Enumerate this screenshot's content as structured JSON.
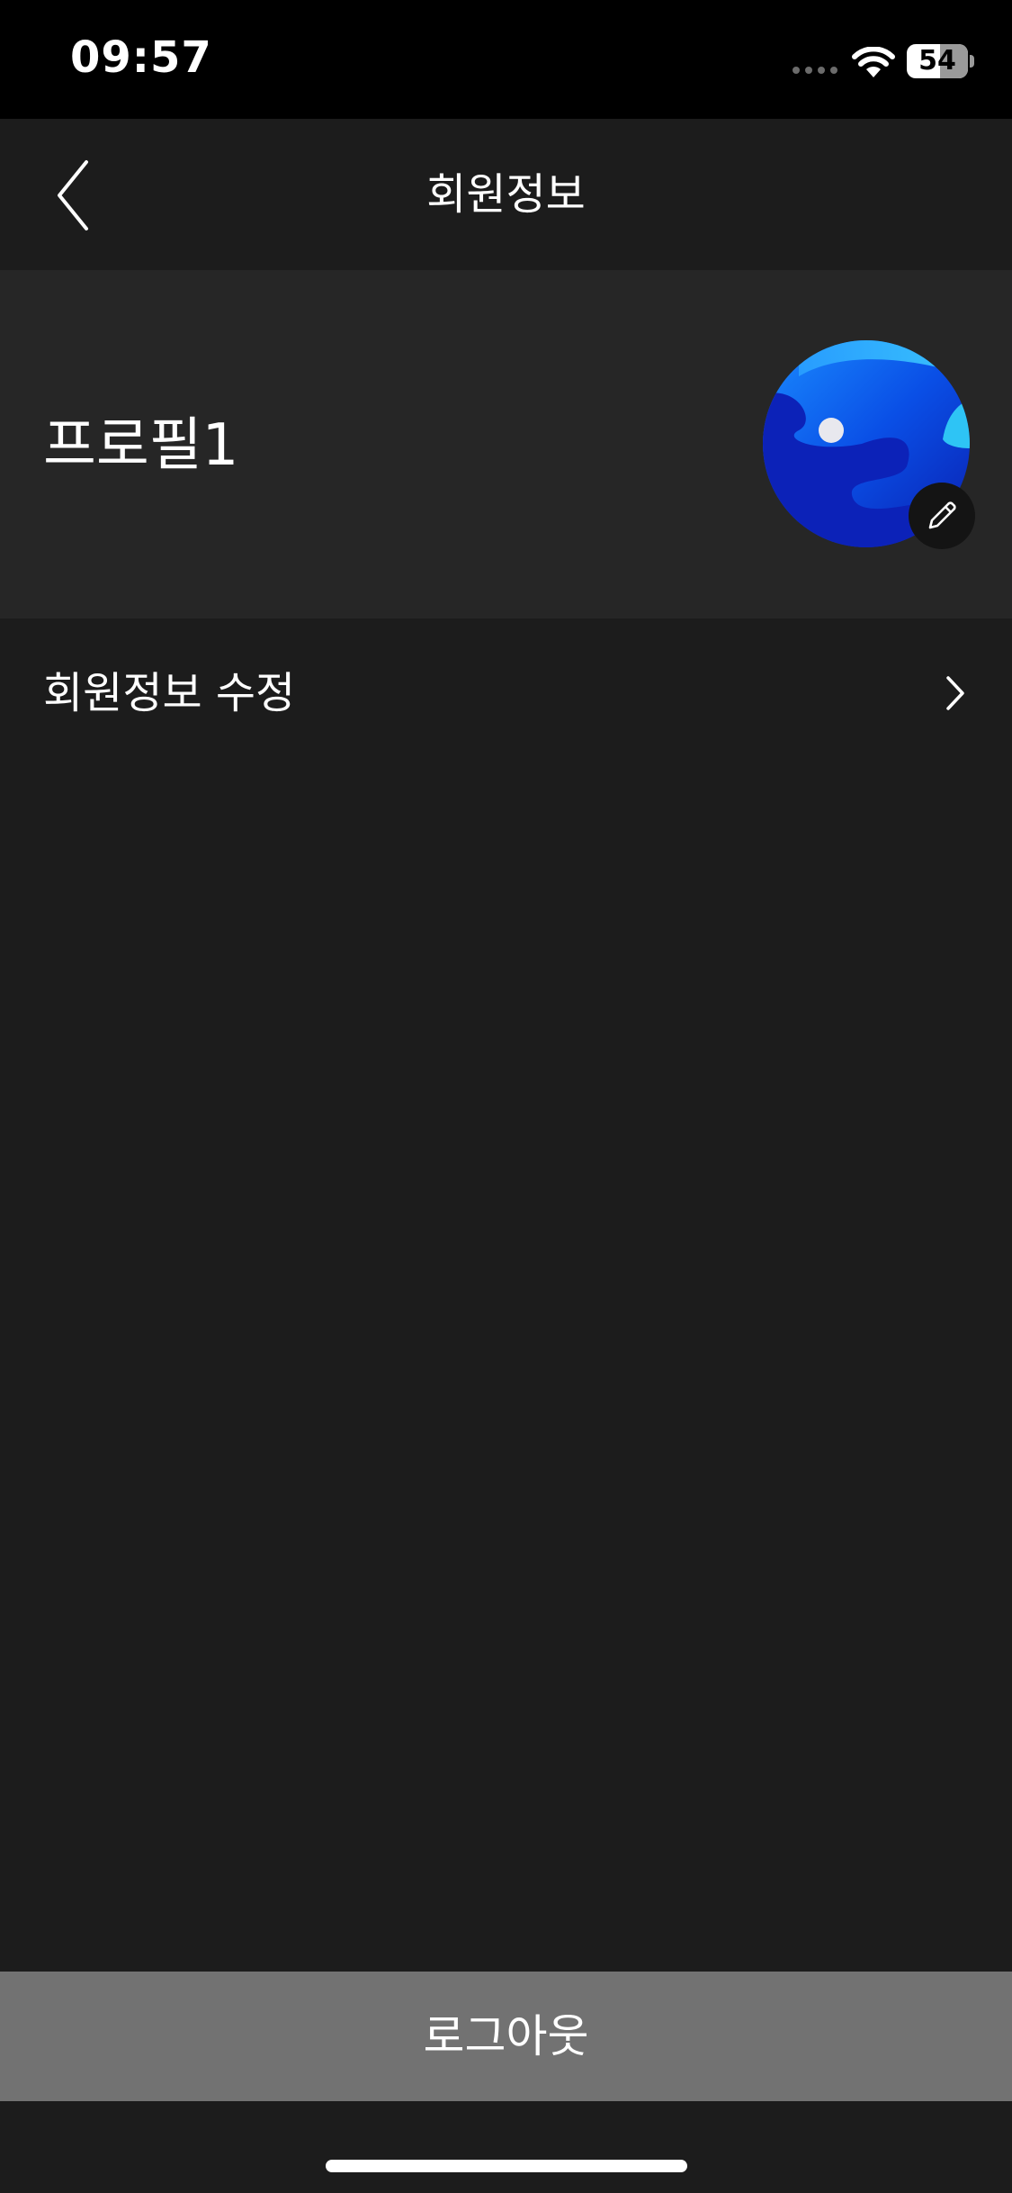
{
  "status_bar": {
    "time": "09:57",
    "battery_percent": "54",
    "battery_level": 0.54,
    "signal_icon": "signal-dots-icon",
    "wifi_icon": "wifi-icon",
    "battery_icon": "battery-icon"
  },
  "nav": {
    "title": "회원정보",
    "back_icon": "chevron-left-icon"
  },
  "profile": {
    "name": "프로필1",
    "avatar_icon": "avatar-image",
    "edit_icon": "pencil-icon"
  },
  "menu": {
    "items": [
      {
        "label": "회원정보 수정",
        "icon": "chevron-right-icon"
      }
    ]
  },
  "footer": {
    "logout_label": "로그아웃"
  },
  "colors": {
    "background": "#1c1c1c",
    "status_bar": "#000000",
    "profile_section": "#262626",
    "logout_button": "#727272",
    "text": "#ffffff"
  }
}
